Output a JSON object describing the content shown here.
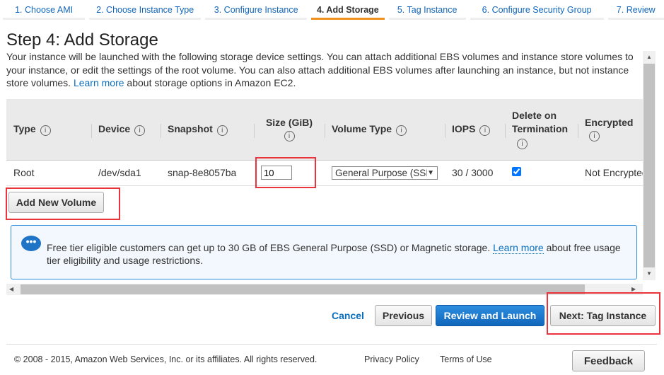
{
  "wizard": {
    "tabs": [
      {
        "label": "1. Choose AMI"
      },
      {
        "label": "2. Choose Instance Type"
      },
      {
        "label": "3. Configure Instance"
      },
      {
        "label": "4. Add Storage",
        "active": true
      },
      {
        "label": "5. Tag Instance"
      },
      {
        "label": "6. Configure Security Group"
      },
      {
        "label": "7. Review"
      }
    ]
  },
  "page": {
    "title": "Step 4: Add Storage",
    "desc_before": "Your instance will be launched with the following storage device settings. You can attach additional EBS volumes and instance store volumes to your instance, or edit the settings of the root volume. You can also attach additional EBS volumes after launching an instance, but not instance store volumes. ",
    "learn_more": "Learn more",
    "desc_after": " about storage options in Amazon EC2."
  },
  "table": {
    "headers": [
      "Type",
      "Device",
      "Snapshot",
      "Size (GiB)",
      "Volume Type",
      "IOPS",
      "Delete on Termination",
      "Encrypted"
    ],
    "row": {
      "type": "Root",
      "device": "/dev/sda1",
      "snapshot": "snap-8e8057ba",
      "size": "10",
      "volume_type": "General Purpose (SSD)",
      "iops": "30 / 3000",
      "delete_on_termination": true,
      "encrypted": "Not Encrypted"
    }
  },
  "buttons": {
    "add_volume": "Add New Volume",
    "cancel": "Cancel",
    "previous": "Previous",
    "review": "Review and Launch",
    "next": "Next: Tag Instance",
    "feedback": "Feedback"
  },
  "info": {
    "text": "Free tier eligible customers can get up to 30 GB of EBS General Purpose (SSD) or Magnetic storage. ",
    "learn_more": "Learn more",
    "text_after": " about free usage tier eligibility and usage restrictions."
  },
  "footer": {
    "copyright": "© 2008 - 2015, Amazon Web Services, Inc. or its affiliates. All rights reserved.",
    "privacy": "Privacy Policy",
    "terms": "Terms of Use"
  },
  "colors": {
    "accent": "#1166bb",
    "active_tab": "#f0901e",
    "highlight": "#e8343a"
  }
}
